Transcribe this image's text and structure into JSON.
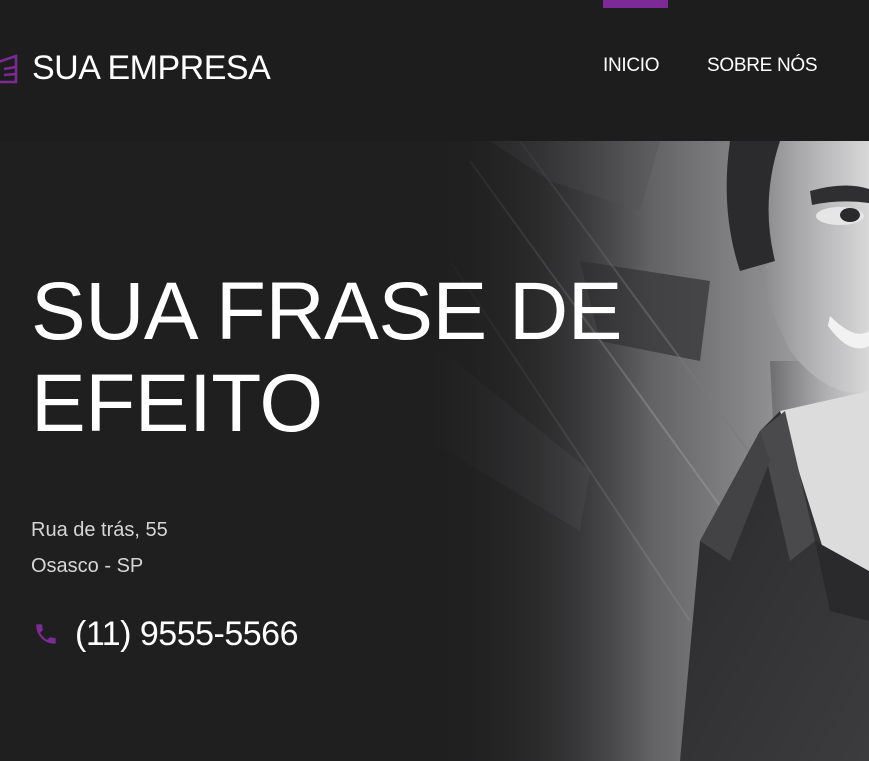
{
  "brand": {
    "name": "SUA EMPRESA",
    "logo_icon": "building-logo-icon",
    "accent_color": "#7b2a96"
  },
  "nav": {
    "items": [
      {
        "label": "INICIO",
        "active": true
      },
      {
        "label": "SOBRE NÓS",
        "active": false
      }
    ]
  },
  "hero": {
    "headline_line1": "SUA FRASE DE",
    "headline_line2": "EFEITO",
    "address_line1": "Rua de trás, 55",
    "address_line2": "Osasco - SP",
    "phone_icon": "phone-icon",
    "phone": "(11) 9555-5566",
    "image": "smiling-businessman-photo"
  }
}
